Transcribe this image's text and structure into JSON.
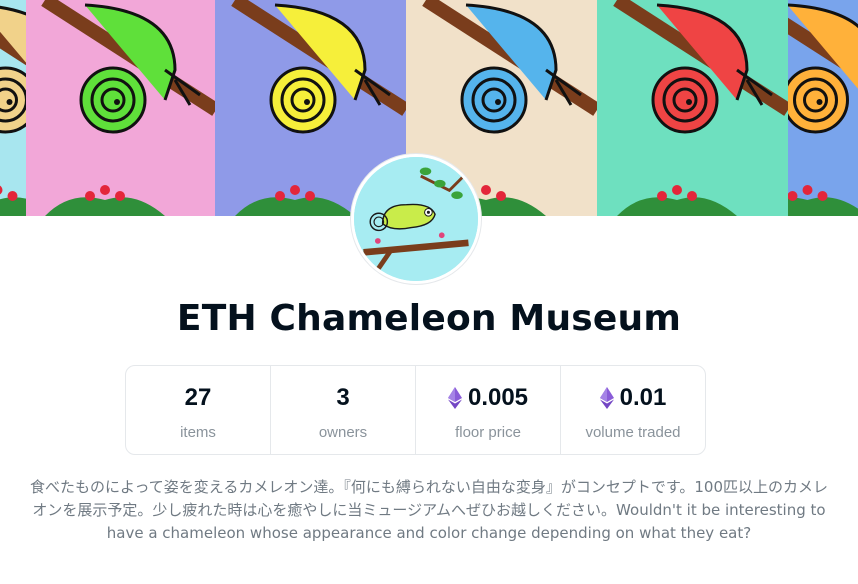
{
  "collection": {
    "name": "ETH Chameleon Museum",
    "description": "食べたものによって姿を変えるカメレオン達。『何にも縛られない自由な変身』がコンセプトです。100匹以上のカメレオンを展示予定。少し疲れた時は心を癒やしに当ミュージアムへぜひお越しください。Wouldn't it be interesting to have a chameleon whose appearance and color change depending on what they eat?"
  },
  "banner": {
    "tiles": [
      {
        "bg": "#a8e6ef",
        "body": "#f1d28a"
      },
      {
        "bg": "#f2a7d8",
        "body": "#5fe03a"
      },
      {
        "bg": "#8f9ae8",
        "body": "#f6ef3a"
      },
      {
        "bg": "#f1e1c9",
        "body": "#55b4ec"
      },
      {
        "bg": "#6ee0bf",
        "body": "#ef4444"
      },
      {
        "bg": "#79a4ec",
        "body": "#ffb13a"
      }
    ]
  },
  "avatar": {
    "icon": "chameleon-avatar-icon",
    "bg": "#a7ecf2"
  },
  "stats": [
    {
      "value": "27",
      "label": "items",
      "eth": false
    },
    {
      "value": "3",
      "label": "owners",
      "eth": false
    },
    {
      "value": "0.005",
      "label": "floor price",
      "eth": true
    },
    {
      "value": "0.01",
      "label": "volume traded",
      "eth": true
    }
  ],
  "colors": {
    "eth_icon": "#8a5cd8",
    "muted_text": "#8a939b",
    "border": "#e5e8eb"
  }
}
